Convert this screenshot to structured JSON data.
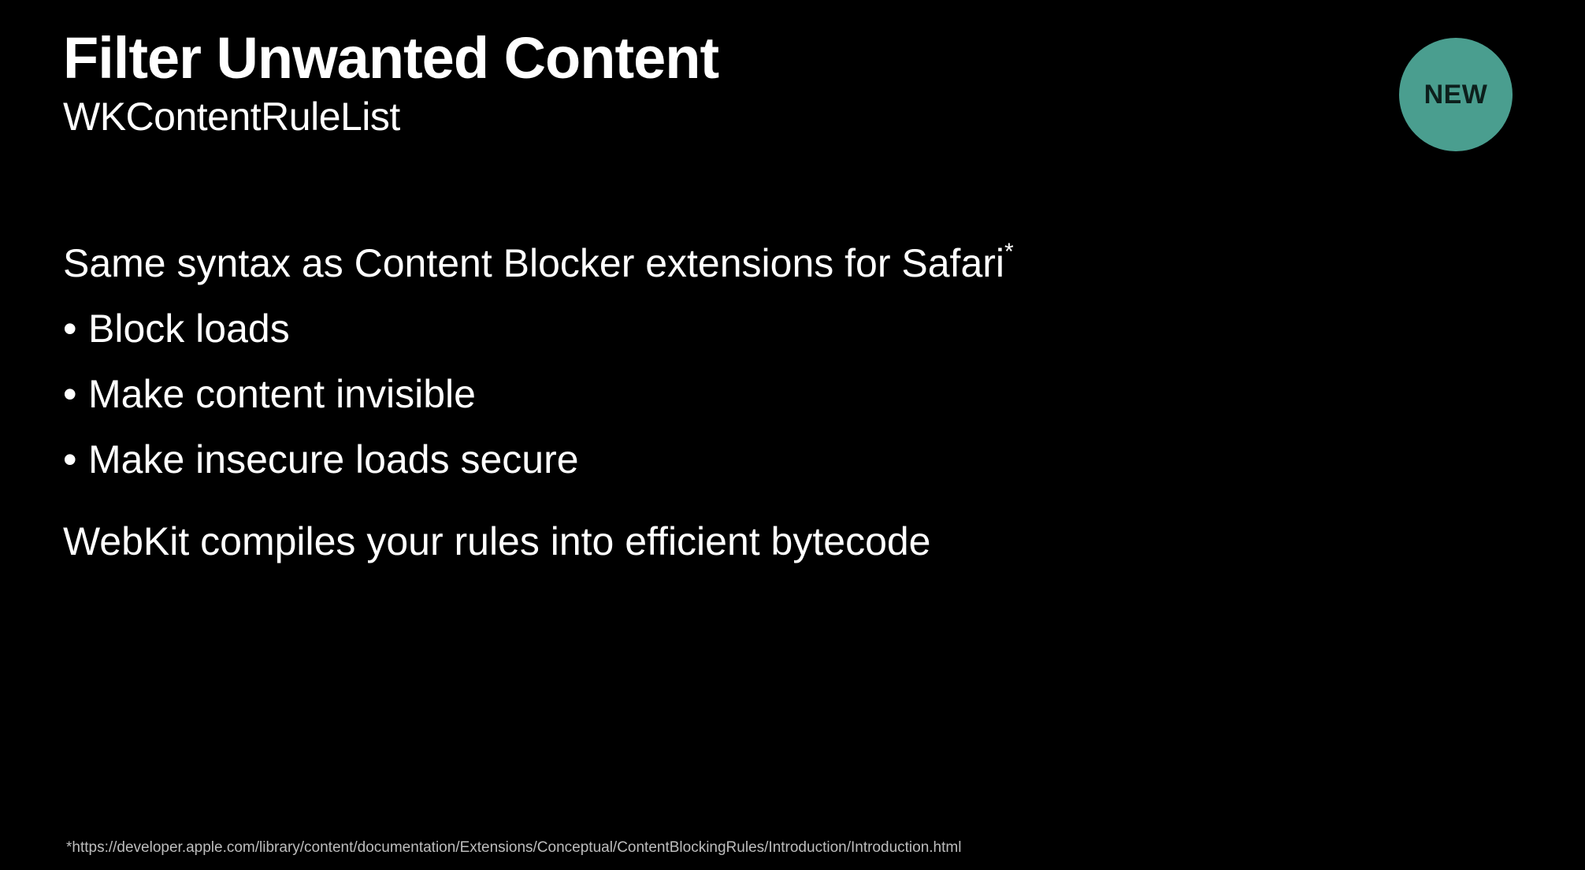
{
  "slide": {
    "title": "Filter Unwanted Content",
    "subtitle": "WKContentRuleList",
    "badge": {
      "label": "NEW",
      "color": "#4a9e8f"
    },
    "intro_text": "Same syntax as Content Blocker extensions for Safari",
    "intro_marker": "*",
    "bullet_symbol": "•",
    "bullets": [
      "Block loads",
      "Make content invisible",
      "Make insecure loads secure"
    ],
    "closing_text": "WebKit compiles your rules into efficient bytecode",
    "footnote": "*https://developer.apple.com/library/content/documentation/Extensions/Conceptual/ContentBlockingRules/Introduction/Introduction.html"
  }
}
